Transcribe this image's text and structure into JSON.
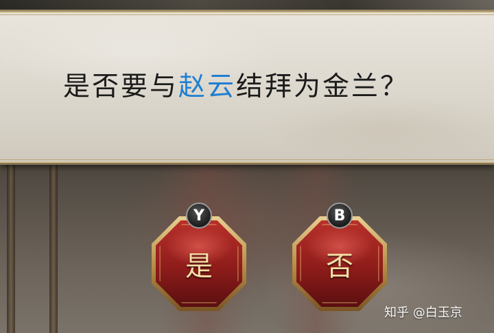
{
  "dialog": {
    "question_before": "是否要与",
    "question_highlight": "赵云",
    "question_after": "结拜为金兰？"
  },
  "options": [
    {
      "key": "Y",
      "label": "是"
    },
    {
      "key": "B",
      "label": "否"
    }
  ],
  "watermark": "知乎 @白玉京",
  "colors": {
    "highlight_name": "#1f7fd1",
    "button_red": "#8e1c1a",
    "button_gold": "#b48a44"
  }
}
